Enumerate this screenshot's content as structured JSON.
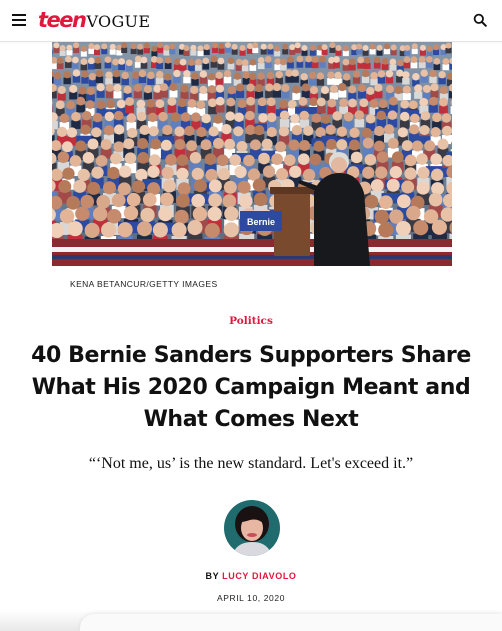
{
  "header": {
    "logo_teen": "teen",
    "logo_vogue": "VOGUE",
    "menu_icon": "hamburger-menu-icon",
    "search_icon": "search-icon"
  },
  "article": {
    "photo_credit": "KENA BETANCUR/GETTY IMAGES",
    "rubric": "Politics",
    "headline": "40 Bernie Sanders Supporters Share What His 2020 Campaign Meant and What Comes Next",
    "dek": "“‘Not me, us’ is the new standard. Let's exceed it.”",
    "byline_prefix": "BY",
    "author": "LUCY DIAVOLO",
    "date": "APRIL 10, 2020",
    "hero_sign_text": "Bernie"
  },
  "colors": {
    "brand_red": "#e0183d",
    "text": "#111111"
  }
}
